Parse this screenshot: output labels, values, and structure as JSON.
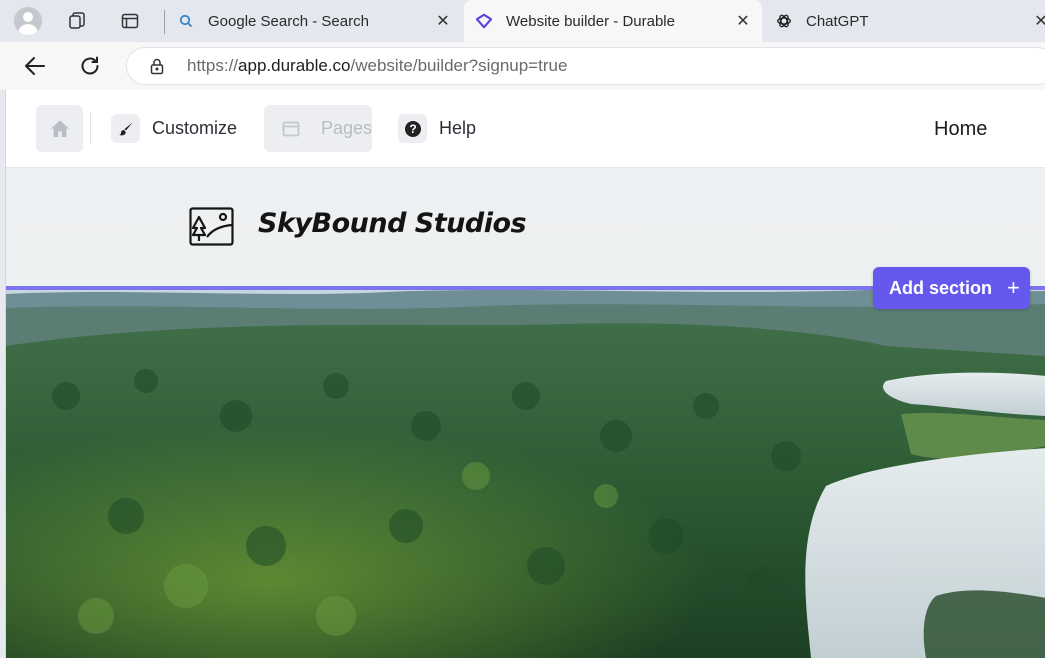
{
  "browser": {
    "tabs": [
      {
        "title": "Google Search - Search",
        "icon": "search-icon",
        "active": false
      },
      {
        "title": "Website builder - Durable",
        "icon": "durable-logo-icon",
        "active": true
      },
      {
        "title": "ChatGPT",
        "icon": "chatgpt-logo-icon",
        "active": false
      }
    ],
    "close_glyph": "✕",
    "url_prefix": "https://",
    "url_domain": "app.durable.co",
    "url_path": "/website/builder?signup=true"
  },
  "toolbar": {
    "customize_label": "Customize",
    "pages_label": "Pages",
    "help_label": "Help",
    "home_label": "Home"
  },
  "site": {
    "brand_name": "SkyBound Studios",
    "add_section_label": "Add section",
    "add_section_plus": "+"
  },
  "colors": {
    "accent": "#6558ee",
    "divider": "#7b74f0",
    "active_tab": "#f7f7f8",
    "tabbar": "#e4e8ee"
  }
}
